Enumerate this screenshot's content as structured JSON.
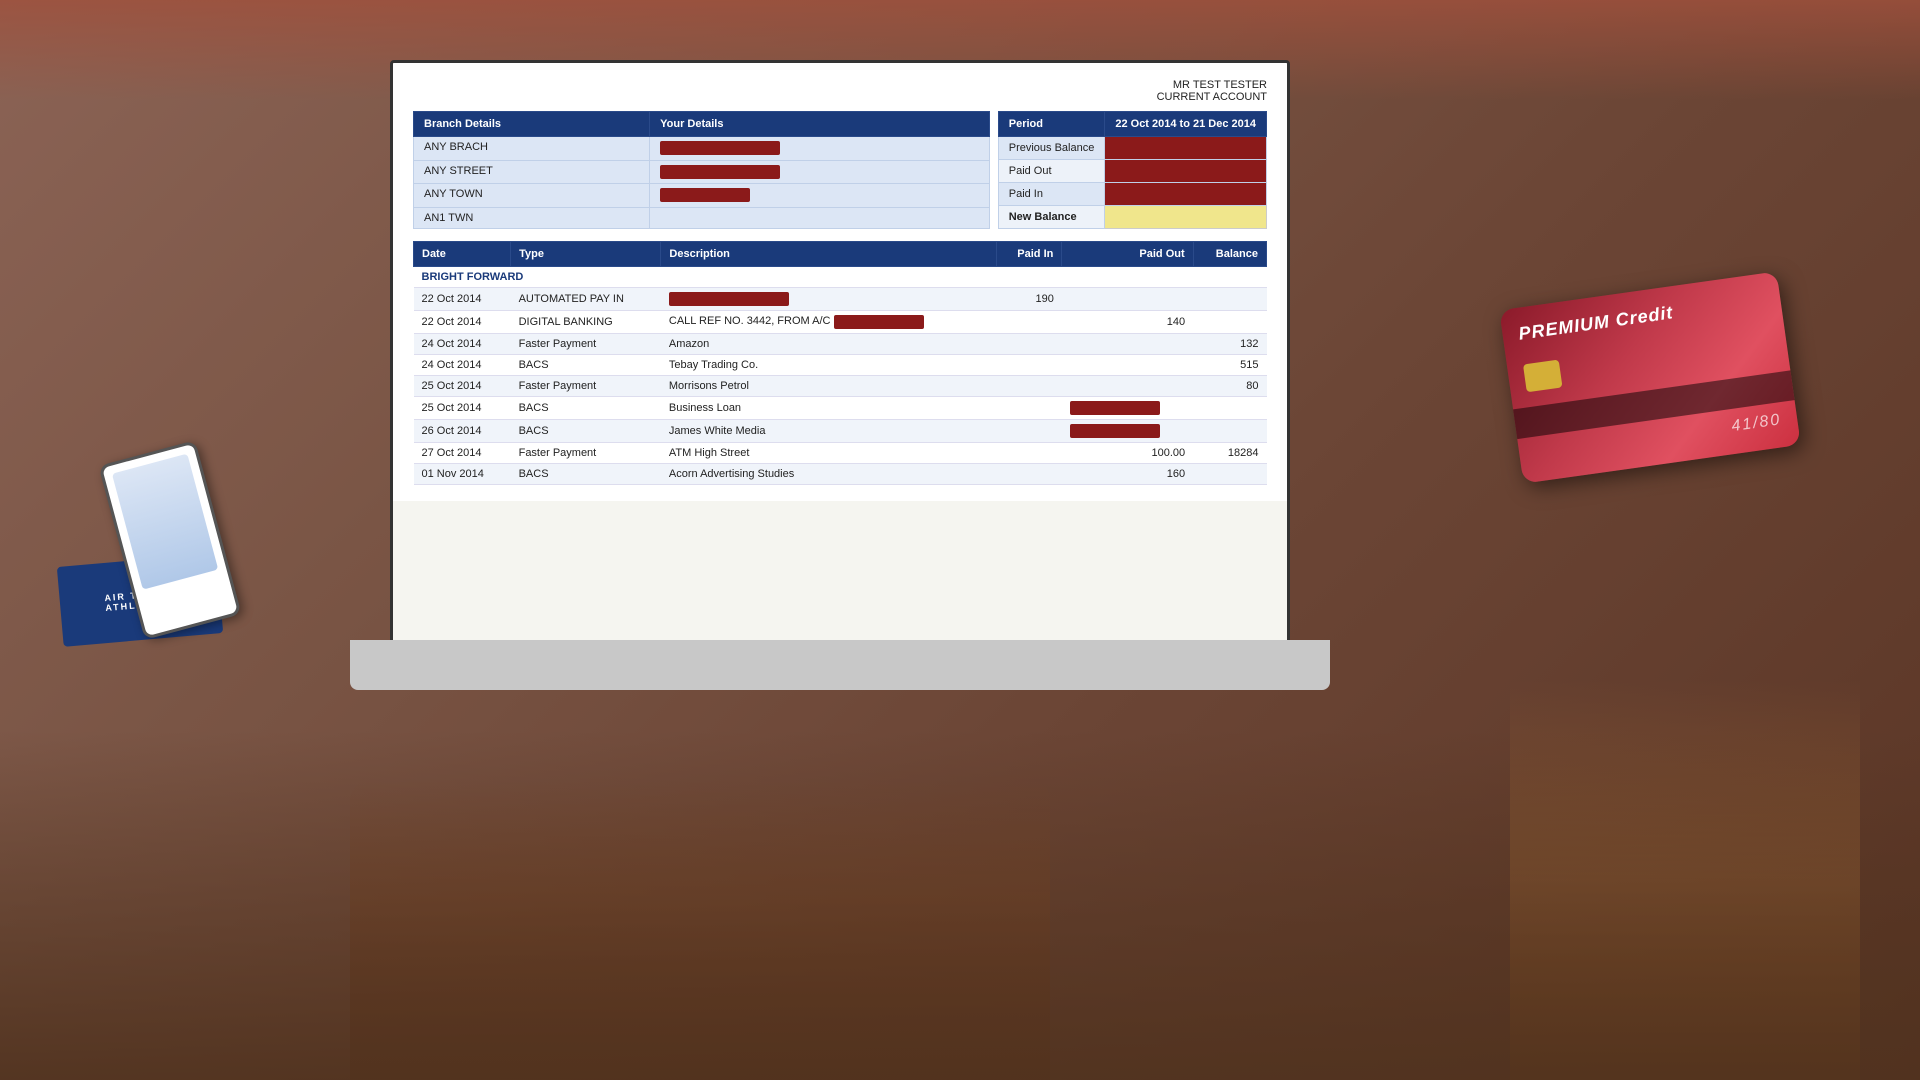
{
  "account": {
    "name": "MR TEST TESTER",
    "type": "CURRENT ACCOUNT",
    "branchDetails": {
      "label": "Branch Details",
      "line1": "ANY BRACH",
      "line2": "ANY STREET",
      "line3": "ANY TOWN",
      "line4": "AN1 TWN"
    },
    "yourDetails": {
      "label": "Your Details"
    },
    "period": {
      "label": "Period",
      "value": "22 Oct 2014 to 21 Dec 2014"
    },
    "summary": {
      "previousBalance": {
        "label": "Previous Balance"
      },
      "paidOut": {
        "label": "Paid Out"
      },
      "paidIn": {
        "label": "Paid In"
      },
      "newBalance": {
        "label": "New Balance"
      }
    }
  },
  "transactions": {
    "headers": {
      "date": "Date",
      "type": "Type",
      "description": "Description",
      "paidIn": "Paid In",
      "paidOut": "Paid Out",
      "balance": "Balance"
    },
    "brightForward": "BRIGHT FORWARD",
    "rows": [
      {
        "date": "22 Oct 2014",
        "type": "AUTOMATED PAY IN",
        "description": "",
        "paidIn": "190",
        "paidOut": "",
        "balance": ""
      },
      {
        "date": "22 Oct 2014",
        "type": "DIGITAL BANKING",
        "description": "CALL REF NO. 3442, FROM A/C",
        "paidIn": "",
        "paidOut": "140",
        "balance": ""
      },
      {
        "date": "24 Oct 2014",
        "type": "Faster Payment",
        "description": "Amazon",
        "paidIn": "",
        "paidOut": "",
        "balance": "132"
      },
      {
        "date": "24 Oct 2014",
        "type": "BACS",
        "description": "Tebay Trading Co.",
        "paidIn": "",
        "paidOut": "",
        "balance": "515"
      },
      {
        "date": "25 Oct 2014",
        "type": "Faster Payment",
        "description": "Morrisons Petrol",
        "paidIn": "",
        "paidOut": "",
        "balance": "80"
      },
      {
        "date": "25 Oct 2014",
        "type": "BACS",
        "description": "Business Loan",
        "paidIn": "",
        "paidOut": "",
        "balance": ""
      },
      {
        "date": "26 Oct 2014",
        "type": "BACS",
        "description": "James White Media",
        "paidIn": "",
        "paidOut": "",
        "balance": ""
      },
      {
        "date": "27 Oct 2014",
        "type": "Faster Payment",
        "description": "ATM High Street",
        "paidIn": "",
        "paidOut": "100.00",
        "balance": "18284"
      },
      {
        "date": "01 Nov 2014",
        "type": "BACS",
        "description": "Acorn Advertising Studies",
        "paidIn": "",
        "paidOut": "160",
        "balance": ""
      }
    ]
  },
  "creditCard": {
    "title": "PREMIUM Credit",
    "number": "41/80"
  },
  "airTicket": {
    "line1": "AIR TICKET",
    "line2": "ATHL TINE"
  }
}
